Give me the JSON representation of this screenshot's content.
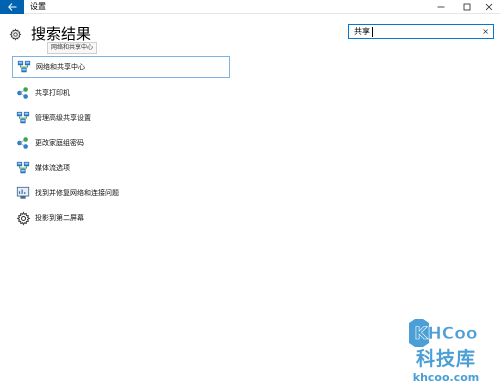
{
  "window": {
    "title": "设置"
  },
  "header": {
    "title": "搜索结果"
  },
  "search": {
    "value": "共享",
    "clear": "×"
  },
  "tooltip": {
    "text": "网络和共享中心"
  },
  "results": [
    {
      "label": "网络和共享中心",
      "icon": "network-icon",
      "selected": true
    },
    {
      "label": "共享打印机",
      "icon": "homegroup-icon"
    },
    {
      "label": "管理高级共享设置",
      "icon": "network-icon"
    },
    {
      "label": "更改家庭组密码",
      "icon": "homegroup-icon"
    },
    {
      "label": "媒体流选项",
      "icon": "network-icon"
    },
    {
      "label": "找到并修复网络和连接问题",
      "icon": "troubleshoot-icon"
    },
    {
      "label": "投影到第二屏幕",
      "icon": "gear-icon"
    }
  ],
  "watermark": {
    "logo_text": "KHCoo",
    "name": "科技库",
    "url": "khcoo.com"
  },
  "colors": {
    "accent": "#0063b1",
    "focus_border": "#0078d7",
    "selection_border": "#7fb2e0",
    "watermark": "#4a9fd6"
  }
}
